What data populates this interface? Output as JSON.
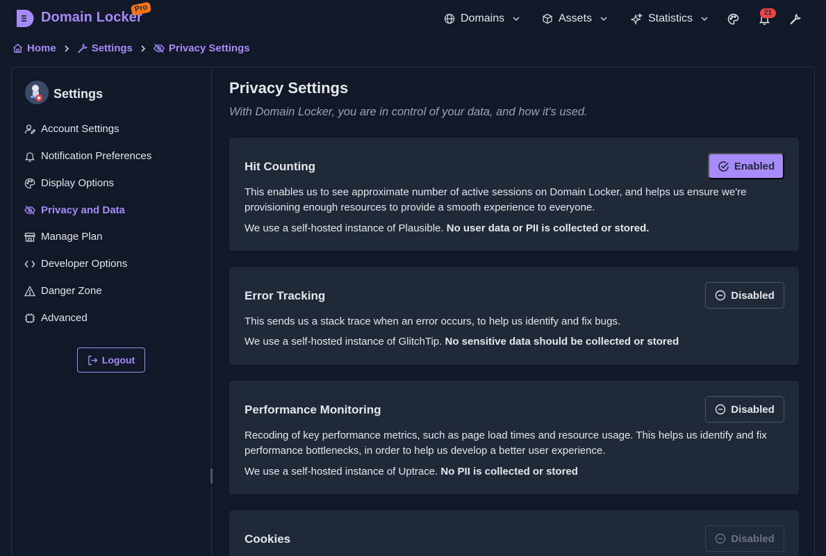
{
  "header": {
    "brand": "Domain Locker",
    "badge": "Pro",
    "nav": [
      {
        "label": "Domains",
        "icon": "globe-icon"
      },
      {
        "label": "Assets",
        "icon": "box-icon"
      },
      {
        "label": "Statistics",
        "icon": "sparkle-icon"
      }
    ],
    "notification_count": "21",
    "right_icons": [
      "palette-icon",
      "bell-icon",
      "wrench-icon"
    ]
  },
  "breadcrumb": [
    {
      "label": "Home",
      "icon": "home-icon"
    },
    {
      "label": "Settings",
      "icon": "wrench-icon"
    },
    {
      "label": "Privacy Settings",
      "icon": "eye-slash-icon"
    }
  ],
  "sidebar": {
    "title": "Settings",
    "items": [
      {
        "label": "Account Settings",
        "icon": "user-edit-icon",
        "active": false
      },
      {
        "label": "Notification Preferences",
        "icon": "bell-icon",
        "active": false
      },
      {
        "label": "Display Options",
        "icon": "palette-icon",
        "active": false
      },
      {
        "label": "Privacy and Data",
        "icon": "eye-slash-icon",
        "active": true
      },
      {
        "label": "Manage Plan",
        "icon": "shop-icon",
        "active": false
      },
      {
        "label": "Developer Options",
        "icon": "code-icon",
        "active": false
      },
      {
        "label": "Danger Zone",
        "icon": "warning-icon",
        "active": false
      },
      {
        "label": "Advanced",
        "icon": "chip-icon",
        "active": false
      }
    ],
    "logout_label": "Logout"
  },
  "main": {
    "title": "Privacy Settings",
    "subtitle": "With Domain Locker, you are in control of your data, and how it's used.",
    "cards": [
      {
        "title": "Hit Counting",
        "status": "Enabled",
        "description": "This enables us to see approximate number of active sessions on Domain Locker, and helps us ensure we're provisioning enough resources to provide a smooth experience to everyone.",
        "note_prefix": "We use a self-hosted instance of Plausible.",
        "note_bold": "No user data or PII is collected or stored."
      },
      {
        "title": "Error Tracking",
        "status": "Disabled",
        "description": "This sends us a stack trace when an error occurs, to help us identify and fix bugs.",
        "note_prefix": "We use a self-hosted instance of GlitchTip.",
        "note_bold": "No sensitive data should be collected or stored"
      },
      {
        "title": "Performance Monitoring",
        "status": "Disabled",
        "description": "Recoding of key performance metrics, such as page load times and resource usage. This helps us identify and fix performance bottlenecks, in order to help us develop a better user experience.",
        "note_prefix": "We use a self-hosted instance of Uptrace.",
        "note_bold": "No PII is collected or stored"
      },
      {
        "title": "Cookies",
        "status": "Disabled"
      }
    ]
  },
  "colors": {
    "accent": "#a78bfa",
    "background": "#111827",
    "card": "#1f2937",
    "badge": "#f97316",
    "notification": "#ef4444"
  }
}
